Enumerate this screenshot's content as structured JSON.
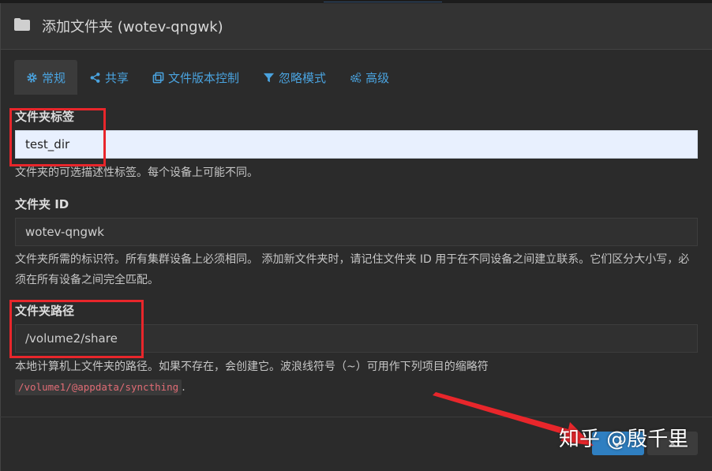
{
  "modal": {
    "title": "添加文件夹 (wotev-qngwk)",
    "folder_icon": "folder-icon"
  },
  "tabs": [
    {
      "label": "常规",
      "icon": "gear-icon",
      "active": true
    },
    {
      "label": "共享",
      "icon": "share-icon",
      "active": false
    },
    {
      "label": "文件版本控制",
      "icon": "copy-icon",
      "active": false
    },
    {
      "label": "忽略模式",
      "icon": "filter-icon",
      "active": false
    },
    {
      "label": "高级",
      "icon": "cogs-icon",
      "active": false
    }
  ],
  "folder_label": {
    "label": "文件夹标签",
    "value": "test_dir",
    "help": "文件夹的可选描述性标签。每个设备上可能不同。"
  },
  "folder_id": {
    "label": "文件夹 ID",
    "value": "wotev-qngwk",
    "help": "文件夹所需的标识符。所有集群设备上必须相同。 添加新文件夹时，请记住文件夹 ID 用于在不同设备之间建立联系。它们区分大小写，必须在所有设备之间完全匹配。"
  },
  "folder_path": {
    "label": "文件夹路径",
    "value": "/volume2/share",
    "help": "本地计算机上文件夹的路径。如果不存在，会创建它。波浪线符号（~）可用作下列项目的缩略符",
    "help_code": "/volume1/@appdata/syncthing",
    "help_suffix": "."
  },
  "footer": {
    "watermark": "知乎 @殷千里"
  },
  "colors": {
    "accent": "#4aa3df",
    "highlight_box": "#e8262b",
    "arrow": "#e8262b",
    "primary_button": "#2f7fc1"
  }
}
